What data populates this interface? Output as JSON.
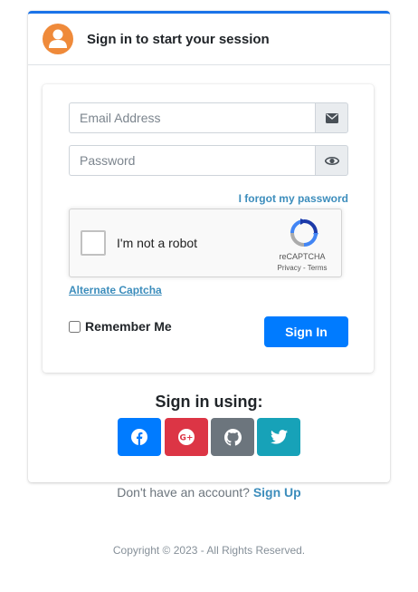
{
  "header": {
    "title": "Sign in to start your session"
  },
  "form": {
    "email_placeholder": "Email Address",
    "password_placeholder": "Password",
    "forgot_label": "I forgot my password",
    "remember_label": "Remember Me",
    "signin_label": "Sign In",
    "alternate_captcha": "Alternate Captcha"
  },
  "recaptcha": {
    "label": "I'm not a robot",
    "brand": "reCAPTCHA",
    "links": "Privacy - Terms"
  },
  "social": {
    "title": "Sign in using:",
    "buttons": [
      {
        "name": "facebook",
        "color": "#007bff"
      },
      {
        "name": "google-plus",
        "color": "#dc3545"
      },
      {
        "name": "github",
        "color": "#6c757d"
      },
      {
        "name": "twitter",
        "color": "#17a2b8"
      }
    ]
  },
  "footer": {
    "no_account": "Don't have an account?",
    "signup_label": "Sign Up",
    "copyright": "Copyright © 2023 - All Rights Reserved."
  },
  "colors": {
    "accent": "#1a73e8",
    "primary": "#007bff",
    "link": "#3c8dbc",
    "avatar": "#ef8a3a"
  }
}
